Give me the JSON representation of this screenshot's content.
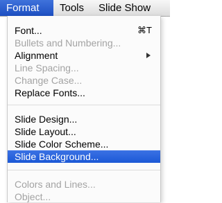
{
  "menubar": {
    "items": [
      {
        "label": "Format",
        "active": true
      },
      {
        "label": "Tools",
        "active": false
      },
      {
        "label": "Slide Show",
        "active": false
      }
    ]
  },
  "menu": {
    "groups": [
      [
        {
          "label": "Font...",
          "shortcut": "⌘T",
          "enabled": true
        },
        {
          "label": "Bullets and Numbering...",
          "enabled": false
        },
        {
          "label": "Alignment",
          "submenu": true,
          "enabled": true
        },
        {
          "label": "Line Spacing...",
          "enabled": false
        },
        {
          "label": "Change Case...",
          "enabled": false
        },
        {
          "label": "Replace Fonts...",
          "enabled": true
        }
      ],
      [
        {
          "label": "Slide Design...",
          "enabled": true
        },
        {
          "label": "Slide Layout...",
          "enabled": true
        },
        {
          "label": "Slide Color Scheme...",
          "enabled": true
        },
        {
          "label": "Slide Background...",
          "enabled": true,
          "highlighted": true
        }
      ],
      [
        {
          "label": "Colors and Lines...",
          "enabled": false
        },
        {
          "label": "Object...",
          "enabled": false
        }
      ]
    ]
  },
  "colors": {
    "highlight": "#1f5fd8",
    "disabled_text": "#a3a3a3"
  }
}
